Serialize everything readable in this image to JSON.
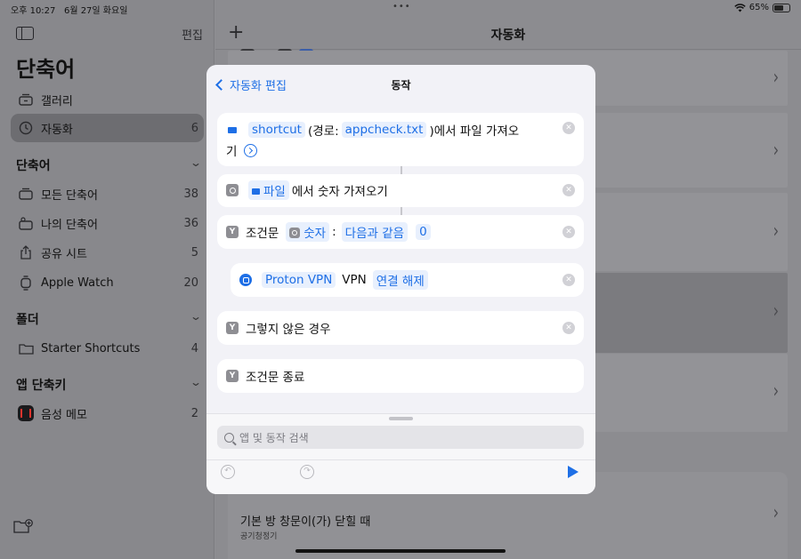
{
  "status_bar": {
    "time": "오후 10:27",
    "date": "6월 27일 화요일",
    "battery": "65%",
    "battery_level": 0.65
  },
  "sidebar": {
    "edit_label": "편집",
    "title": "단축어",
    "top_items": [
      {
        "label": "갤러리",
        "icon": "gallery-icon"
      },
      {
        "label": "자동화",
        "count": "6",
        "icon": "clock-icon",
        "selected": true
      }
    ],
    "sections": [
      {
        "title": "단축어",
        "items": [
          {
            "label": "모든 단축어",
            "count": "38"
          },
          {
            "label": "나의 단축어",
            "count": "36"
          },
          {
            "label": "공유 시트",
            "count": "5"
          },
          {
            "label": "Apple Watch",
            "count": "20"
          }
        ]
      },
      {
        "title": "폴더",
        "items": [
          {
            "label": "Starter Shortcuts",
            "count": "4"
          }
        ]
      },
      {
        "title": "앱 단축키",
        "items": [
          {
            "label": "음성 메모",
            "count": "2"
          }
        ]
      }
    ]
  },
  "main": {
    "title": "자동화",
    "bottom_card": {
      "title": "기본 방 창문이(가) 닫힐 때",
      "subtitle": "공기청정기"
    }
  },
  "modal": {
    "back_label": "자동화 편집",
    "title": "동작",
    "action1": {
      "token1": "shortcut",
      "text1": "(경로:",
      "token2": "appcheck.txt",
      "text2": ")에서 파일 가져오",
      "text3": "기"
    },
    "action2": {
      "token": "파일",
      "text": "에서 숫자 가져오기"
    },
    "action3": {
      "label": "조건문",
      "token1": "숫자",
      "colon": ":",
      "token2": "다음과 같음",
      "token3": "0"
    },
    "action4": {
      "token1": "Proton VPN",
      "text": "VPN",
      "token2": "연결 해제"
    },
    "action5": {
      "label": "그렇지 않은 경우"
    },
    "action6": {
      "label": "조건문 종료"
    },
    "search_placeholder": "앱 및 동작 검색"
  },
  "colors": {
    "accent": "#1e6fe6",
    "dimmed_bg": "#8e8e92",
    "modal_bg": "#f2f2f7"
  }
}
